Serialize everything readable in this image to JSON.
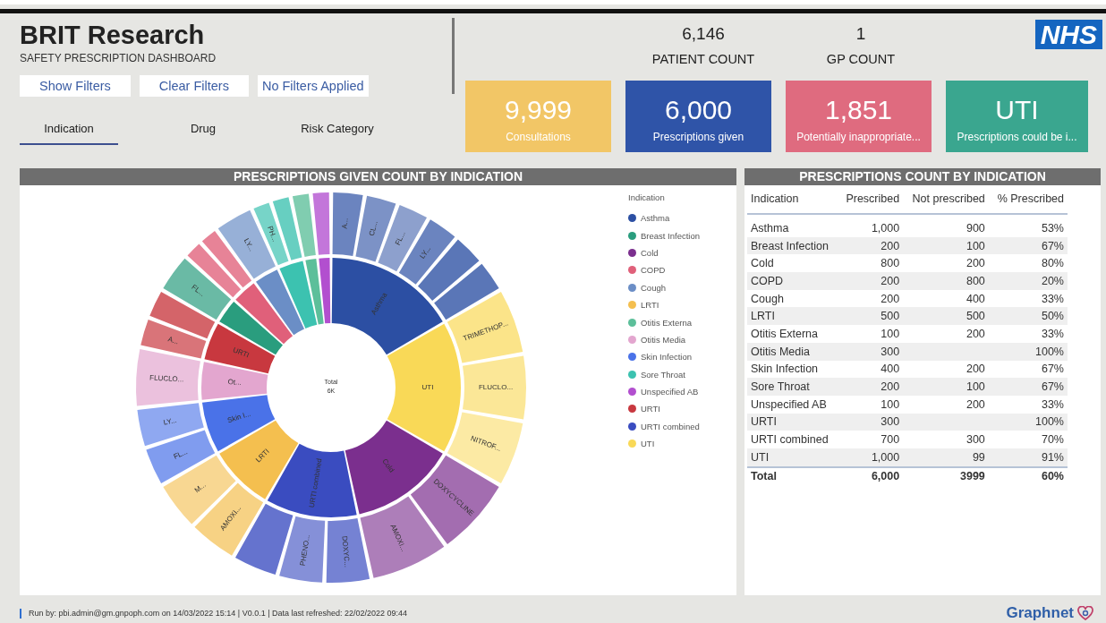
{
  "header": {
    "title": "BRIT Research",
    "subtitle": "SAFETY PRESCRIPTION DASHBOARD",
    "buttons": [
      "Show Filters",
      "Clear Filters",
      "No Filters Applied"
    ],
    "tabs": [
      {
        "label": "Indication",
        "selected": true
      },
      {
        "label": "Drug",
        "selected": false
      },
      {
        "label": "Risk Category",
        "selected": false
      }
    ],
    "stats": [
      {
        "value": "6,146",
        "label": "PATIENT COUNT"
      },
      {
        "value": "1",
        "label": "GP COUNT"
      }
    ],
    "logo": "NHS"
  },
  "cards": [
    {
      "value": "9,999",
      "label": "Consultations",
      "color": "#f2c666"
    },
    {
      "value": "6,000",
      "label": "Prescriptions given",
      "color": "#2f54a8"
    },
    {
      "value": "1,851",
      "label": "Potentially inappropriate...",
      "color": "#df6b7f"
    },
    {
      "value": "UTI",
      "label": "Prescriptions could be i...",
      "color": "#3aa68f"
    }
  ],
  "sunburst": {
    "title": "PRESCRIPTIONS GIVEN COUNT BY INDICATION",
    "center_label": "Total",
    "center_value": "6K",
    "legend_title": "Indication",
    "legend": [
      {
        "name": "Asthma",
        "color": "#2c4fa3",
        "label": "Asthma",
        "outer": [
          {
            "label": "A..."
          },
          {
            "label": "CL..."
          },
          {
            "label": "FL..."
          },
          {
            "label": "LY..."
          },
          {
            "kind": "blank"
          },
          {
            "kind": "blank"
          }
        ]
      },
      {
        "name": "Breast Infection",
        "color": "#2a9d7e",
        "outer": [
          {
            "label": "FL..."
          }
        ]
      },
      {
        "name": "Cold",
        "color": "#7b2f8e",
        "label": "Cold",
        "outer": [
          {
            "label": "DOXYCYCLINE"
          },
          {
            "label": "AMOXI..."
          }
        ]
      },
      {
        "name": "COPD",
        "color": "#e0607a",
        "outer": [
          {
            "kind": "blank"
          },
          {
            "kind": "blank"
          }
        ]
      },
      {
        "name": "Cough",
        "color": "#6b8ec6",
        "outer": [
          {
            "label": "LY..."
          }
        ]
      },
      {
        "name": "LRTI",
        "color": "#f4bf4f",
        "label": "LRTI",
        "outer": [
          {
            "label": "AMOXI..."
          },
          {
            "label": "M..."
          }
        ]
      },
      {
        "name": "Otitis Externa",
        "color": "#5cbf9a",
        "outer": [
          {
            "kind": "blank"
          }
        ]
      },
      {
        "name": "Otitis Media",
        "color": "#e3a6cf",
        "label": "Ot...",
        "outer": [
          {
            "label": "FLUCLO..."
          }
        ]
      },
      {
        "name": "Skin Infection",
        "color": "#4a72e8",
        "label": "Skin I...",
        "outer": [
          {
            "label": "FL..."
          },
          {
            "label": "LY..."
          }
        ]
      },
      {
        "name": "Sore Throat",
        "color": "#3cc2b0",
        "outer": [
          {
            "label": "PH..."
          },
          {
            "kind": "blank"
          }
        ]
      },
      {
        "name": "Unspecified AB",
        "color": "#b24fcf",
        "outer": [
          {
            "kind": "blank"
          }
        ]
      },
      {
        "name": "URTI",
        "color": "#c8383f",
        "label": "URTI",
        "outer": [
          {
            "label": "A..."
          },
          {
            "kind": "blank"
          }
        ]
      },
      {
        "name": "URTI combined",
        "color": "#3a4cc0",
        "label": "URTI combined",
        "outer": [
          {
            "label": "DOXYC..."
          },
          {
            "label": "PHENO..."
          },
          {
            "kind": "blank"
          }
        ]
      },
      {
        "name": "UTI",
        "color": "#f9d957",
        "label": "UTI",
        "outer": [
          {
            "label": "TRIMETHOP..."
          },
          {
            "label": "FLUCLO..."
          },
          {
            "label": "NITROF..."
          }
        ]
      }
    ]
  },
  "table": {
    "title": "PRESCRIPTIONS COUNT BY INDICATION",
    "columns": [
      "Indication",
      "Prescribed",
      "Not prescribed",
      "% Prescribed"
    ],
    "rows": [
      [
        "Asthma",
        "1,000",
        "900",
        "53%"
      ],
      [
        "Breast Infection",
        "200",
        "100",
        "67%"
      ],
      [
        "Cold",
        "800",
        "200",
        "80%"
      ],
      [
        "COPD",
        "200",
        "800",
        "20%"
      ],
      [
        "Cough",
        "200",
        "400",
        "33%"
      ],
      [
        "LRTI",
        "500",
        "500",
        "50%"
      ],
      [
        "Otitis Externa",
        "100",
        "200",
        "33%"
      ],
      [
        "Otitis Media",
        "300",
        null,
        "100%"
      ],
      [
        "Skin Infection",
        "400",
        "200",
        "67%"
      ],
      [
        "Sore Throat",
        "200",
        "100",
        "67%"
      ],
      [
        "Unspecified AB",
        "100",
        "200",
        "33%"
      ],
      [
        "URTI",
        "300",
        null,
        "100%"
      ],
      [
        "URTI combined",
        "700",
        "300",
        "70%"
      ],
      [
        "UTI",
        "1,000",
        "99",
        "91%"
      ]
    ],
    "total": [
      "Total",
      "6,000",
      "3999",
      "60%"
    ]
  },
  "footer": {
    "text": "Run by: pbi.admin@gm.gnpoph.com on 14/03/2022 15:14 | V0.0.1 | Data last refreshed: 22/02/2022 09:44",
    "brand": "Graphnet"
  }
}
